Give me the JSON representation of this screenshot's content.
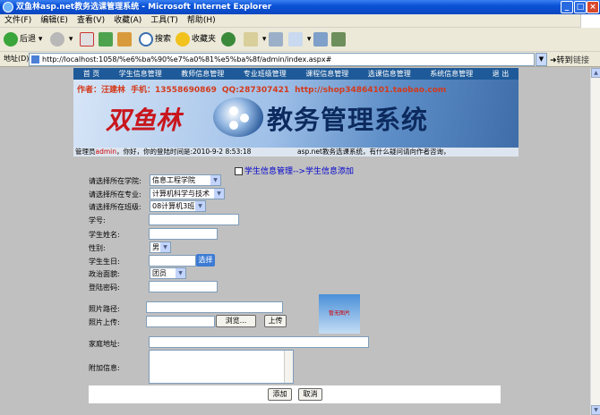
{
  "window": {
    "title": "双鱼林asp.net教务选课管理系统 - Microsoft Internet Explorer"
  },
  "menu": [
    "文件(F)",
    "编辑(E)",
    "查看(V)",
    "收藏(A)",
    "工具(T)",
    "帮助(H)"
  ],
  "toolbar": {
    "back": "后退",
    "search": "搜索",
    "favorites": "收藏夹"
  },
  "address": {
    "label": "地址(D)",
    "url": "http://localhost:1058/%e6%ba%90%e7%a0%81%e5%ba%8f/admin/index.aspx#",
    "go": "转到",
    "links": "链接"
  },
  "nav": [
    "首 页",
    "学生信息管理",
    "教师信息管理",
    "专业班级管理",
    "课程信息管理",
    "选课信息管理",
    "系统信息管理",
    "退 出"
  ],
  "banner": {
    "author": "作者：汪建林",
    "phone": "手机：13558690869",
    "qq": "QQ:287307421",
    "shop": "http://shop34864101.taobao.com",
    "logo1": "双鱼林",
    "logo2": "教务管理系统"
  },
  "infobar": {
    "prefix": "管理员",
    "admin": "admin",
    "suffix": "，你好，你的登陆时间是:2010-9-2 8:53:18",
    "notice": "asp.net教务选课系统，有什么疑问请向作者咨询，"
  },
  "breadcrumb": "学生信息管理-->学生信息添加",
  "form": {
    "college_label": "请选择所在学院:",
    "college_value": "信息工程学院",
    "major_label": "请选择所在专业:",
    "major_value": "计算机科学与技术",
    "class_label": "请选择所在班级:",
    "class_value": "08计算机3班",
    "student_no_label": "学号:",
    "name_label": "学生姓名:",
    "gender_label": "性别:",
    "gender_value": "男",
    "birthday_label": "学生生日:",
    "choose_button": "选择",
    "politics_label": "政治面貌:",
    "politics_value": "团员",
    "password_label": "登陆密码:",
    "photo_path_label": "照片路径:",
    "photo_upload_label": "照片上传:",
    "browse_button": "浏览...",
    "upload_button": "上传",
    "photo_preview_text": "暂无图片",
    "address_label": "家庭地址:",
    "extra_label": "附加信息:",
    "add_button": "添加",
    "cancel_button": "取消"
  }
}
